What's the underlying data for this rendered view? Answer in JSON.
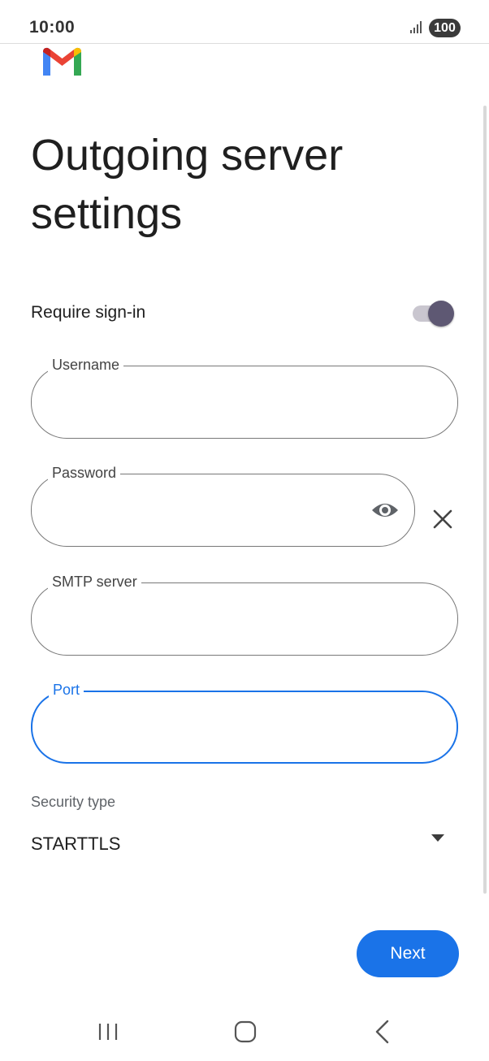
{
  "status_bar": {
    "time": "10:00",
    "battery": "100",
    "signal_icon": "signal-bars-icon"
  },
  "app": {
    "logo_icon": "gmail-logo-icon",
    "logo_colors": [
      "#EA4335",
      "#4285F4",
      "#34A853",
      "#FBBC04",
      "#C5221F"
    ]
  },
  "page": {
    "title": "Outgoing server settings"
  },
  "require_signin": {
    "label": "Require sign-in",
    "enabled": true
  },
  "fields": {
    "username": {
      "label": "Username",
      "value": ""
    },
    "password": {
      "label": "Password",
      "value": "",
      "visibility_icon": "eye-icon",
      "clear_icon": "close-icon"
    },
    "smtp_server": {
      "label": "SMTP server",
      "value": ""
    },
    "port": {
      "label": "Port",
      "value": "",
      "focused": true
    }
  },
  "security": {
    "caption": "Security type",
    "selected": "STARTTLS",
    "dropdown_icon": "dropdown-arrow-icon"
  },
  "actions": {
    "next_label": "Next"
  },
  "nav": {
    "recents_icon": "recents-icon",
    "home_icon": "home-icon",
    "back_icon": "back-icon"
  },
  "colors": {
    "accent": "#1a73e8",
    "toggle_thumb": "#5e5873",
    "toggle_track": "#c9c6cf",
    "outline": "#787878"
  }
}
